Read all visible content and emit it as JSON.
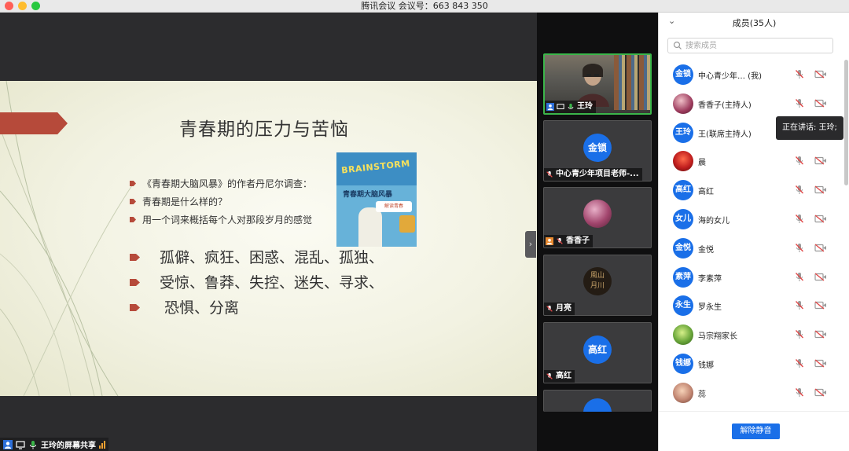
{
  "window": {
    "title": "腾讯会议 会议号：663 843 350"
  },
  "slide": {
    "title": "青春期的压力与苦恼",
    "bullets": [
      "《青春期大脑风暴》的作者丹尼尔调查：",
      "青春期是什么样的？",
      "用一个词来概括每个人对那段岁月的感觉"
    ],
    "big_lines": [
      "孤僻、疯狂、困惑、混乱、孤独、",
      "受惊、鲁莽、失控、迷失、寻求、",
      "恐惧、分离"
    ],
    "book": {
      "word": "BRAINSTORM",
      "title": "青春期大脑风暴",
      "sub": "解读青春"
    }
  },
  "stage_badge": {
    "label": "王玲的屏幕共享"
  },
  "video_strip": {
    "tiles": [
      {
        "name": "王玲",
        "kind": "video"
      },
      {
        "name": "中心青少年项目老师-...",
        "avatar": "金锁",
        "kind": "avatar"
      },
      {
        "name": "香香子",
        "kind": "photo"
      },
      {
        "name": "月亮",
        "kind": "calligraphy",
        "calli_text": "風山 月川"
      },
      {
        "name": "高红",
        "avatar": "高红",
        "kind": "avatar"
      }
    ]
  },
  "panel": {
    "title": "成员(35人)",
    "search_placeholder": "搜索成员",
    "members": [
      {
        "avatar": "金锁",
        "name": "中心青少年…  (我)",
        "style": "blue"
      },
      {
        "avatar": "",
        "name": "香香子(主持人)",
        "style": "ph1"
      },
      {
        "avatar": "王玲",
        "name": "王(联席主持人)",
        "style": "blue"
      },
      {
        "avatar": "",
        "name": "晨",
        "style": "ph2"
      },
      {
        "avatar": "高红",
        "name": "高红",
        "style": "blue"
      },
      {
        "avatar": "女儿",
        "name": "海的女儿",
        "style": "blue"
      },
      {
        "avatar": "金悦",
        "name": "金悦",
        "style": "blue"
      },
      {
        "avatar": "素萍",
        "name": "李素萍",
        "style": "blue"
      },
      {
        "avatar": "永生",
        "name": "罗永生",
        "style": "blue"
      },
      {
        "avatar": "",
        "name": "马宗翔家长",
        "style": "ph3"
      },
      {
        "avatar": "钱娜",
        "name": "钱娜",
        "style": "blue"
      },
      {
        "avatar": "",
        "name": "蕊",
        "style": "ph4"
      }
    ],
    "tooltip": "正在讲话: 王玲;",
    "unmute_label": "解除静音"
  },
  "colors": {
    "accent": "#1a6fe8",
    "speaking": "#3bb54a",
    "slide_arrow": "#b64a3a"
  }
}
